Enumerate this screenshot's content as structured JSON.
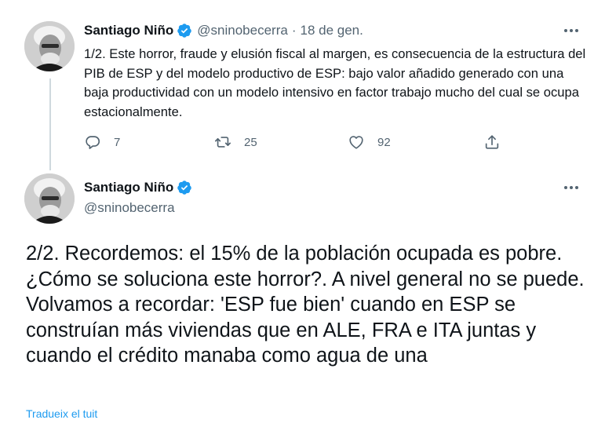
{
  "tweet1": {
    "author_name": "Santiago Niño",
    "handle": "@sninobecerra",
    "separator": "·",
    "date": "18 de gen.",
    "text": "1/2. Este horror, fraude y elusión fiscal al margen, es consecuencia de la estructura del PIB de ESP y del modelo productivo de ESP: bajo valor añadido generado con una baja productividad con un modelo intensivo en factor trabajo mucho del cual se ocupa estacionalmente.",
    "actions": {
      "reply_icon": "reply-icon",
      "reply_count": "7",
      "retweet_icon": "retweet-icon",
      "retweet_count": "25",
      "like_icon": "heart-icon",
      "like_count": "92",
      "share_icon": "share-icon"
    }
  },
  "tweet2": {
    "author_name": "Santiago Niño",
    "handle": "@sninobecerra",
    "text": "2/2. Recordemos: el 15% de la población ocupada es pobre. ¿Cómo se soluciona este horror?. A nivel general no se puede. Volvamos a recordar: 'ESP fue bien' cuando en ESP se construían más viviendas que en ALE, FRA e ITA juntas y cuando el crédito manaba como agua de una",
    "translate_link": "Tradueix el tuit"
  },
  "colors": {
    "accent": "#1d9bf0",
    "text_primary": "#0f1419",
    "text_secondary": "#536471",
    "thread_line": "#cfd9de"
  }
}
